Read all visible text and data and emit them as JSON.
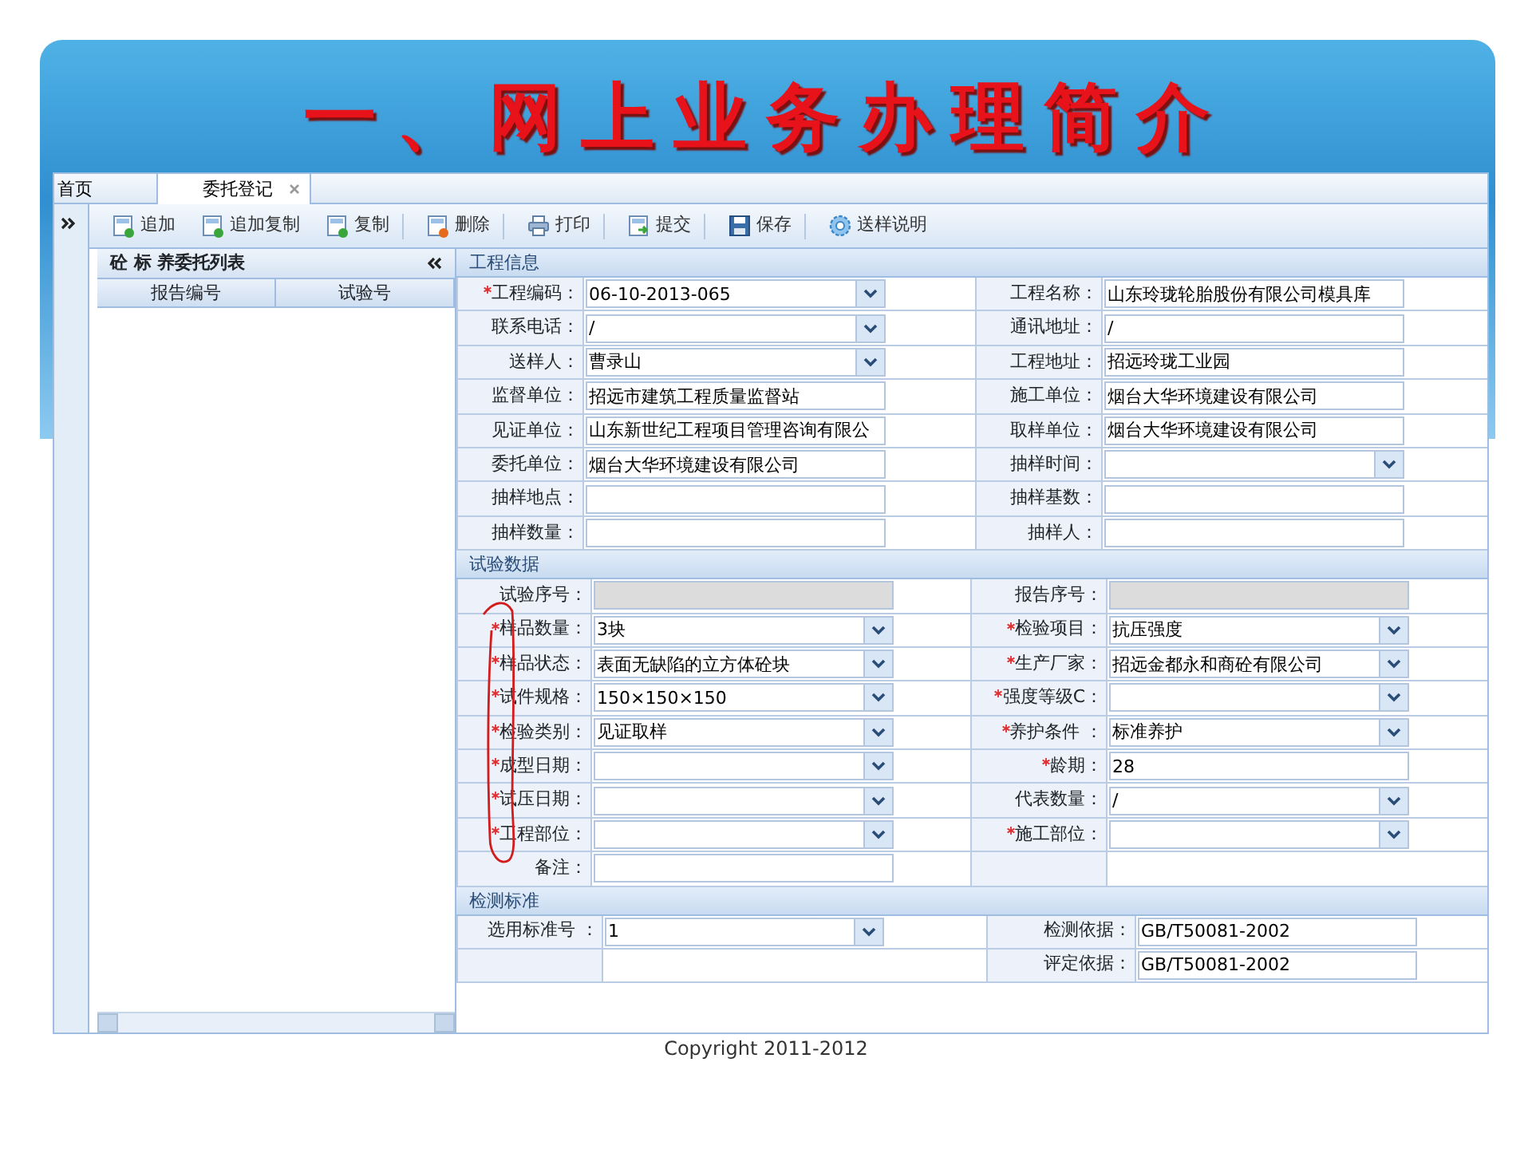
{
  "slide": {
    "title": "一、网上业务办理简介"
  },
  "tabs": [
    {
      "label": "首页",
      "selected": false,
      "closable": false
    },
    {
      "label": "委托登记",
      "selected": true,
      "closable": true
    }
  ],
  "toolbar": [
    {
      "label": "追加",
      "kind": "add",
      "separator_after": false
    },
    {
      "label": "追加复制",
      "kind": "add",
      "separator_after": false
    },
    {
      "label": "复制",
      "kind": "add",
      "separator_after": true
    },
    {
      "label": "删除",
      "kind": "remove",
      "separator_after": true
    },
    {
      "label": "打印",
      "kind": "print",
      "separator_after": true
    },
    {
      "label": "提交",
      "kind": "submit",
      "separator_after": true
    },
    {
      "label": "保存",
      "kind": "save",
      "separator_after": true
    },
    {
      "label": "送样说明",
      "kind": "help",
      "separator_after": false
    }
  ],
  "list_panel": {
    "title": "砼 标 养委托列表",
    "columns": [
      "报告编号",
      "试验号"
    ]
  },
  "sections": [
    {
      "title": "工程信息",
      "fields": [
        {
          "label": "工程编码：",
          "required": true,
          "kind": "select",
          "value": "06-10-2013-065"
        },
        {
          "label": "工程名称：",
          "required": false,
          "kind": "text",
          "value": "山东玲珑轮胎股份有限公司模具库"
        },
        {
          "label": "联系电话：",
          "required": false,
          "kind": "select",
          "value": "/"
        },
        {
          "label": "通讯地址：",
          "required": false,
          "kind": "text",
          "value": "/"
        },
        {
          "label": "送样人：",
          "required": false,
          "kind": "select",
          "value": "曹录山"
        },
        {
          "label": "工程地址：",
          "required": false,
          "kind": "text",
          "value": "招远玲珑工业园"
        },
        {
          "label": "监督单位：",
          "required": false,
          "kind": "text",
          "value": "招远市建筑工程质量监督站"
        },
        {
          "label": "施工单位：",
          "required": false,
          "kind": "text",
          "value": "烟台大华环境建设有限公司"
        },
        {
          "label": "见证单位：",
          "required": false,
          "kind": "text",
          "value": "山东新世纪工程项目管理咨询有限公"
        },
        {
          "label": "取样单位：",
          "required": false,
          "kind": "text",
          "value": "烟台大华环境建设有限公司"
        },
        {
          "label": "委托单位：",
          "required": false,
          "kind": "text",
          "value": "烟台大华环境建设有限公司"
        },
        {
          "label": "抽样时间：",
          "required": false,
          "kind": "select"
        },
        {
          "label": "抽样地点：",
          "required": false,
          "kind": "text"
        },
        {
          "label": "抽样基数：",
          "required": false,
          "kind": "text"
        },
        {
          "label": "抽样数量：",
          "required": false,
          "kind": "text"
        },
        {
          "label": "抽样人：",
          "required": false,
          "kind": "text"
        }
      ]
    },
    {
      "title": "试验数据",
      "fields": [
        {
          "label": "试验序号：",
          "required": false,
          "kind": "disabled"
        },
        {
          "label": "报告序号：",
          "required": false,
          "kind": "disabled"
        },
        {
          "label": "样品数量：",
          "required": true,
          "kind": "select",
          "value": "3块"
        },
        {
          "label": "检验项目：",
          "required": true,
          "kind": "select",
          "value": "抗压强度"
        },
        {
          "label": "样品状态：",
          "required": true,
          "kind": "select",
          "value": "表面无缺陷的立方体砼块"
        },
        {
          "label": "生产厂家：",
          "required": true,
          "kind": "select",
          "value": "招远金都永和商砼有限公司"
        },
        {
          "label": "试件规格：",
          "required": true,
          "kind": "select",
          "value": "150×150×150"
        },
        {
          "label": "强度等级C：",
          "required": true,
          "kind": "select"
        },
        {
          "label": "检验类别：",
          "required": true,
          "kind": "select",
          "value": "见证取样"
        },
        {
          "label": "养护条件 ：",
          "required": true,
          "kind": "select",
          "value": "标准养护"
        },
        {
          "label": "成型日期：",
          "required": true,
          "kind": "select"
        },
        {
          "label": "龄期：",
          "required": true,
          "kind": "text",
          "value": "28"
        },
        {
          "label": "试压日期：",
          "required": true,
          "kind": "select"
        },
        {
          "label": "代表数量：",
          "required": false,
          "kind": "select",
          "value": "/"
        },
        {
          "label": "工程部位：",
          "required": true,
          "kind": "select"
        },
        {
          "label": "施工部位：",
          "required": true,
          "kind": "select"
        },
        {
          "label": "备注：",
          "required": false,
          "kind": "text"
        },
        {
          "kind": "blank"
        }
      ]
    },
    {
      "title": "检测标准",
      "fields": [
        {
          "label": "选用标准号 ：",
          "required": false,
          "kind": "select",
          "value": "1"
        },
        {
          "label": "检测依据：",
          "required": false,
          "kind": "text",
          "value": "GB/T50081-2002"
        },
        {
          "kind": "blank"
        },
        {
          "label": "评定依据：",
          "required": false,
          "kind": "text",
          "value": "GB/T50081-2002"
        }
      ]
    }
  ],
  "footer": "Copyright 2011-2012"
}
